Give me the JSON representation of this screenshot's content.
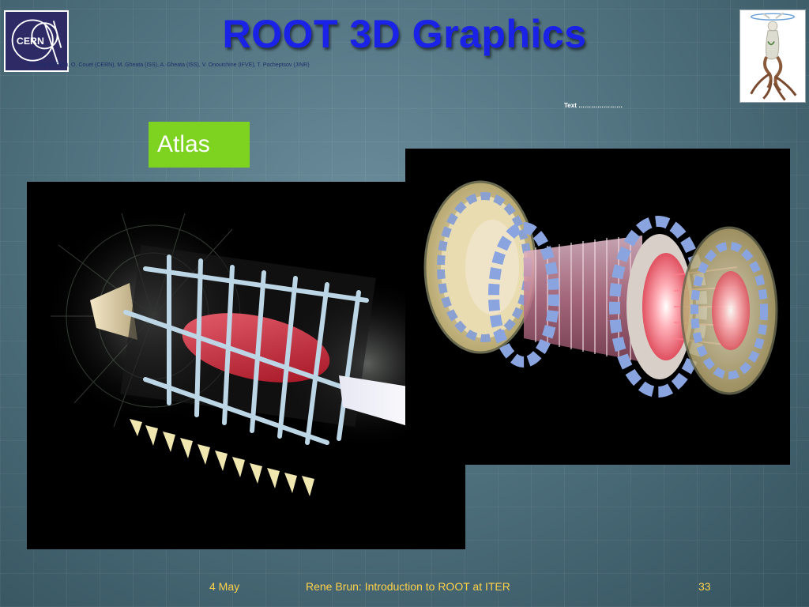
{
  "slide": {
    "title": "ROOT 3D Graphics",
    "authors": "R. Brun (CERN), O. Couet (CERN), M. Gheata (ISS), A. Gheata (ISS), V. Onoutchine (IFVE), T. Pocheptsov (JINR)",
    "text_note": "Text …………………",
    "label": "Atlas",
    "logos": {
      "left": {
        "icon": "cern-logo",
        "text": "CERN"
      },
      "right": {
        "icon": "root-tree-figure-logo"
      }
    },
    "images": {
      "left": {
        "icon": "atlas-barrel-3d-render"
      },
      "right": {
        "icon": "atlas-detector-3d-render"
      }
    },
    "colors": {
      "title": "#1a22e8",
      "label_background": "#7ed321",
      "footer_text": "#ffd24a",
      "background": "#4a6a78"
    }
  },
  "footer": {
    "date": "4 May",
    "title": "Rene Brun: Introduction to ROOT at ITER",
    "page": "33"
  }
}
